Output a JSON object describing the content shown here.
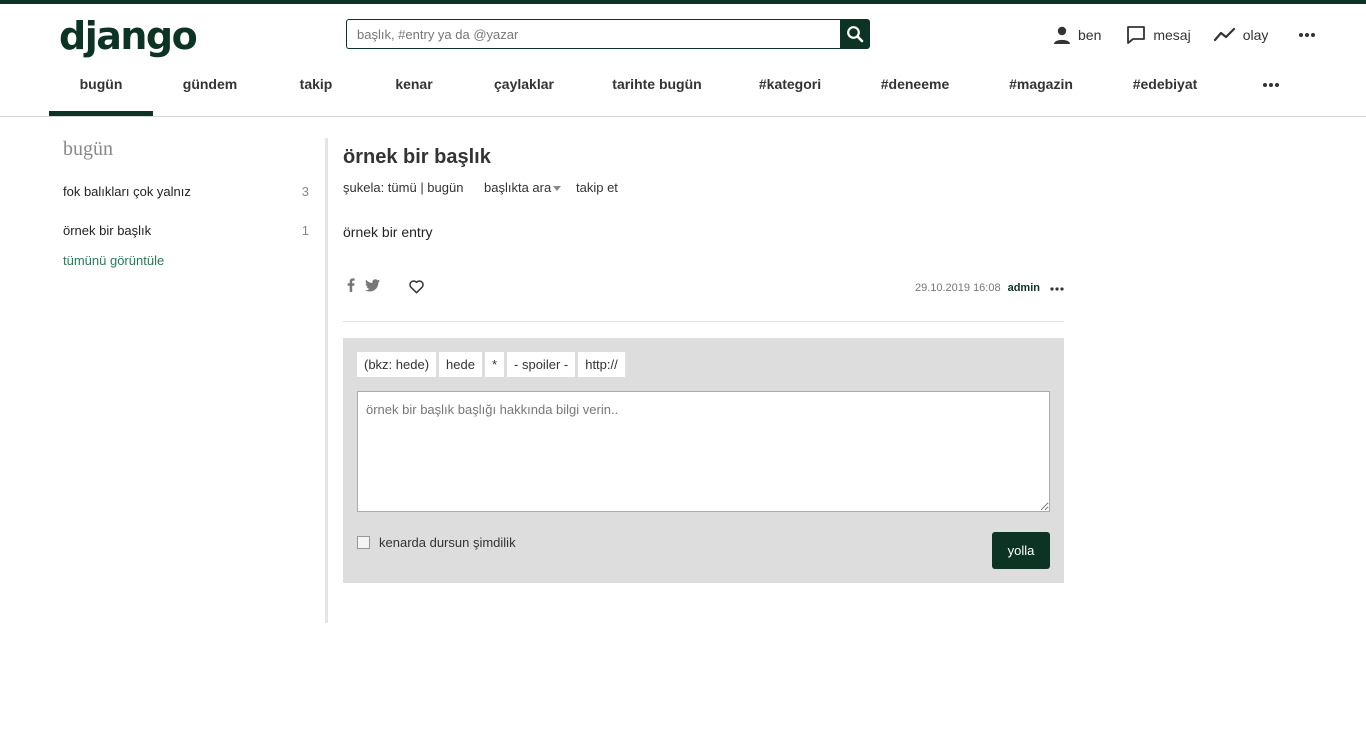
{
  "header": {
    "logo": "django",
    "search_placeholder": "başlık, #entry ya da @yazar",
    "user_items": [
      {
        "label": "ben",
        "icon": "person-icon"
      },
      {
        "label": "mesaj",
        "icon": "message-icon"
      },
      {
        "label": "olay",
        "icon": "activity-icon"
      }
    ],
    "more_icon": "more-icon"
  },
  "nav": {
    "tabs": [
      "bugün",
      "gündem",
      "takip",
      "kenar",
      "çaylaklar",
      "tarihte bugün",
      "#kategori",
      "#deneeme",
      "#magazin",
      "#edebiyat"
    ],
    "active_tab": "bugün"
  },
  "sidebar": {
    "title": "bugün",
    "topics": [
      {
        "title": "fok balıkları çok yalnız",
        "count": "3"
      },
      {
        "title": "örnek bir başlık",
        "count": "1"
      }
    ],
    "see_all": "tümünü görüntüle"
  },
  "topic": {
    "title": "örnek bir başlık",
    "sukela": "şukela: tümü | bugün",
    "search_in_topic": "başlıkta ara",
    "follow": "takip et"
  },
  "entry": {
    "text": "örnek bir entry",
    "date": "29.10.2019 16:08",
    "author": "admin"
  },
  "editor": {
    "tools": [
      "(bkz: hede)",
      "hede",
      "*",
      "- spoiler -",
      "http://"
    ],
    "placeholder": "örnek bir başlık başlığı hakkında bilgi verin..",
    "draft_label": "kenarda dursun şimdilik",
    "submit": "yolla"
  },
  "colors": {
    "brand": "#0c3323",
    "link": "#2a7a55",
    "editor_bg": "#dddddd"
  }
}
